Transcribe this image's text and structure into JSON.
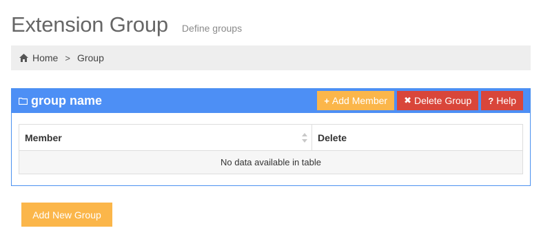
{
  "header": {
    "title": "Extension Group",
    "subtitle": "Define groups"
  },
  "breadcrumb": {
    "home_label": "Home",
    "separator": ">",
    "current_label": "Group"
  },
  "panel": {
    "title": "group name",
    "buttons": {
      "add_member": {
        "icon": "plus-icon",
        "glyph": "+",
        "label": "Add Member"
      },
      "delete_group": {
        "icon": "times-icon",
        "glyph": "✖",
        "label": "Delete Group"
      },
      "help": {
        "icon": "question-icon",
        "glyph": "?",
        "label": "Help"
      }
    },
    "table": {
      "columns": [
        "Member",
        "Delete"
      ],
      "empty_message": "No data available in table"
    }
  },
  "footer": {
    "add_group_label": "Add New Group"
  },
  "colors": {
    "panel_primary": "#4d8ff5",
    "warning": "#fbb64a",
    "danger": "#d9463a",
    "breadcrumb_bg": "#eeeeee"
  }
}
